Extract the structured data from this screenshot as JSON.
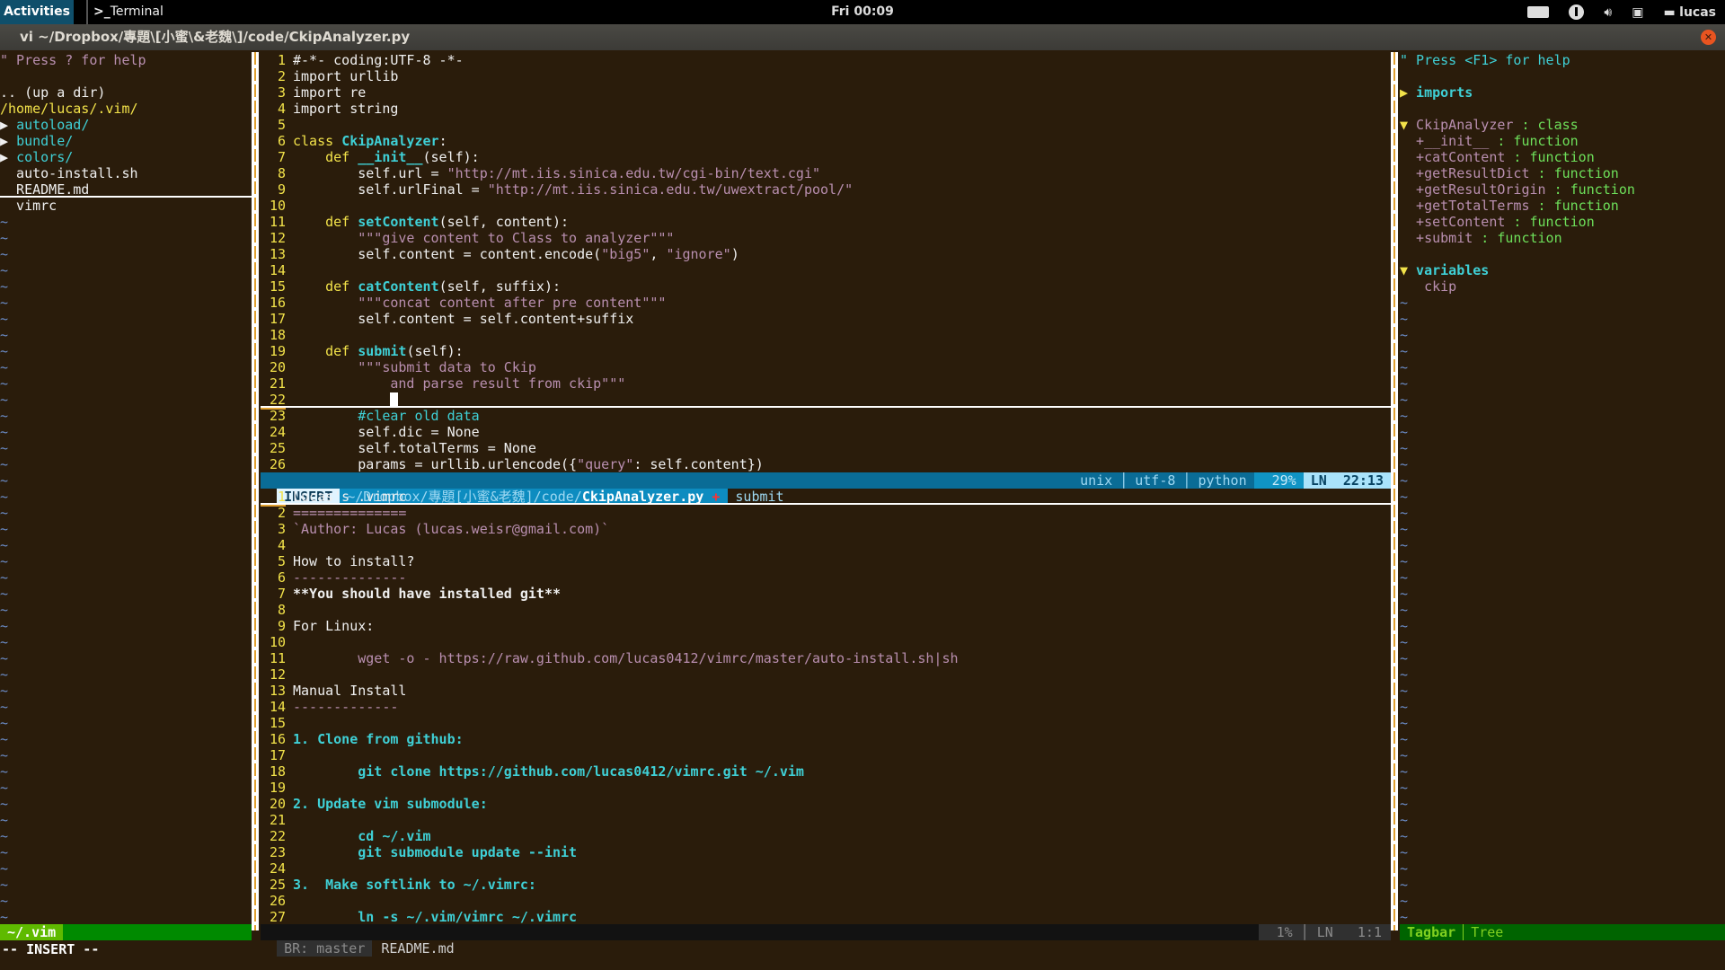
{
  "topbar": {
    "activities": "Activities",
    "app_name": "Terminal",
    "app_prompt": ">_",
    "clock": "Fri 00:09",
    "tray_icons": [
      "keyboard-icon",
      "accessibility-icon",
      "volume-icon",
      "network-icon",
      "chat-icon"
    ],
    "user": "lucas"
  },
  "window": {
    "title": "vi ~/Dropbox/專題\\[小蜜\\&老魏\\]/code/CkipAnalyzer.py",
    "close_icon": "close-icon"
  },
  "nerdtree": {
    "help": "\" Press ? for help",
    "up_dir": ".. (up a dir)",
    "root": "/home/lucas/.vim/",
    "entries": [
      {
        "type": "dir",
        "name": "autoload",
        "slash": "/"
      },
      {
        "type": "dir",
        "name": "bundle",
        "slash": "/"
      },
      {
        "type": "dir",
        "name": "colors",
        "slash": "/"
      },
      {
        "type": "file",
        "name": "auto-install.sh"
      },
      {
        "type": "file",
        "name": "README.md"
      },
      {
        "type": "file",
        "name": "vimrc"
      }
    ],
    "status": "~/.vim"
  },
  "editor_top": {
    "lines": [
      {
        "n": "1",
        "text": "#-*- coding:UTF-8 -*-"
      },
      {
        "n": "2",
        "text": "import urllib"
      },
      {
        "n": "3",
        "text": "import re"
      },
      {
        "n": "4",
        "text": "import string"
      },
      {
        "n": "5",
        "text": ""
      },
      {
        "n": "6",
        "kw": "class ",
        "name": "CkipAnalyzer",
        "rest": ":"
      },
      {
        "n": "7",
        "indent": "    ",
        "kw": "def ",
        "name": "__init__",
        "rest": "(self):"
      },
      {
        "n": "8",
        "indent": "        ",
        "pre": "self.url = ",
        "str": "\"http://mt.iis.sinica.edu.tw/cgi-bin/text.cgi\""
      },
      {
        "n": "9",
        "indent": "        ",
        "pre": "self.urlFinal = ",
        "str": "\"http://mt.iis.sinica.edu.tw/uwextract/pool/\""
      },
      {
        "n": "10",
        "text": ""
      },
      {
        "n": "11",
        "indent": "    ",
        "kw": "def ",
        "name": "setContent",
        "rest": "(self, content):"
      },
      {
        "n": "12",
        "indent": "        ",
        "str": "\"\"\"give content to Class to analyzer\"\"\""
      },
      {
        "n": "13",
        "indent": "        ",
        "pre": "self.content = content.encode(",
        "str": "\"big5\"",
        "mid": ", ",
        "str2": "\"ignore\"",
        "post": ")"
      },
      {
        "n": "14",
        "text": ""
      },
      {
        "n": "15",
        "indent": "    ",
        "kw": "def ",
        "name": "catContent",
        "rest": "(self, suffix):"
      },
      {
        "n": "16",
        "indent": "        ",
        "str": "\"\"\"concat content after pre content\"\"\""
      },
      {
        "n": "17",
        "indent": "        ",
        "pre": "self.content = self.content+suffix"
      },
      {
        "n": "18",
        "text": ""
      },
      {
        "n": "19",
        "indent": "    ",
        "kw": "def ",
        "name": "submit",
        "rest": "(self):"
      },
      {
        "n": "20",
        "indent": "        ",
        "str": "\"\"\"submit data to Ckip"
      },
      {
        "n": "21",
        "indent": "            ",
        "str": "and parse result from ckip\"\"\""
      },
      {
        "n": "22",
        "cursor": true
      },
      {
        "n": "23",
        "indent": "        ",
        "comment": "#clear old data"
      },
      {
        "n": "24",
        "indent": "        ",
        "pre": "self.dic = None"
      },
      {
        "n": "25",
        "indent": "        ",
        "pre": "self.totalTerms = None"
      },
      {
        "n": "26",
        "indent": "        ",
        "pre": "params = urllib.urlencode({",
        "str": "\"query\"",
        "post": ": self.content})"
      }
    ],
    "status": {
      "mode": "INSERT",
      "path_prefix": "~/Dropbox/專題[小蜜&老魏]/code/",
      "filename": "CkipAnalyzer.py",
      "modified": "+",
      "function": "submit",
      "fileformat": "unix",
      "encoding": "utf-8",
      "filetype": "python",
      "percent": "29%",
      "ln_label": "LN",
      "position": "22:13"
    }
  },
  "editor_bottom": {
    "lines": [
      {
        "n": "1",
        "text": "Lucas's .vimrc",
        "style": "white",
        "cursorline": true
      },
      {
        "n": "2",
        "text": "==============",
        "style": "pink"
      },
      {
        "n": "3",
        "text": "`Author: Lucas (lucas.weisr@gmail.com)`",
        "style": "pink"
      },
      {
        "n": "4",
        "text": ""
      },
      {
        "n": "5",
        "text": "How to install?",
        "style": "white"
      },
      {
        "n": "6",
        "text": "--------------",
        "style": "pink"
      },
      {
        "n": "7",
        "text": "**You should have installed git**",
        "style": "white-bold"
      },
      {
        "n": "8",
        "text": ""
      },
      {
        "n": "9",
        "text": "For Linux:",
        "style": "white"
      },
      {
        "n": "10",
        "text": ""
      },
      {
        "n": "11",
        "text": "        wget -o - https://raw.github.com/lucas0412/vimrc/master/auto-install.sh|sh",
        "style": "pink"
      },
      {
        "n": "12",
        "text": ""
      },
      {
        "n": "13",
        "text": "Manual Install",
        "style": "white"
      },
      {
        "n": "14",
        "text": "-------------",
        "style": "pink"
      },
      {
        "n": "15",
        "text": ""
      },
      {
        "n": "16",
        "text": "1. Clone from github:",
        "style": "cyan-bold"
      },
      {
        "n": "17",
        "text": ""
      },
      {
        "n": "18",
        "text": "        git clone https://github.com/lucas0412/vimrc.git ~/.vim",
        "style": "cyan-bold"
      },
      {
        "n": "19",
        "text": ""
      },
      {
        "n": "20",
        "text": "2. Update vim submodule:",
        "style": "cyan-bold"
      },
      {
        "n": "21",
        "text": ""
      },
      {
        "n": "22",
        "text": "        cd ~/.vim",
        "style": "cyan-bold"
      },
      {
        "n": "23",
        "text": "        git submodule update --init",
        "style": "cyan-bold"
      },
      {
        "n": "24",
        "text": ""
      },
      {
        "n": "25",
        "text": "3.  Make softlink to ~/.vimrc:",
        "style": "cyan-bold"
      },
      {
        "n": "26",
        "text": ""
      },
      {
        "n": "27",
        "text": "        ln -s ~/.vim/vimrc ~/.vimrc",
        "style": "cyan-bold"
      }
    ],
    "status": {
      "branch": "BR: master",
      "filename": "README.md",
      "percent": "1%",
      "ln_label": "LN",
      "position": "1:1"
    }
  },
  "tagbar": {
    "help": "\" Press <F1> for help",
    "groups": [
      {
        "name": "imports",
        "collapsed": true,
        "items": []
      },
      {
        "name": "CkipAnalyzer",
        "kind": " : class",
        "collapsed": false,
        "items": [
          {
            "name": "+__init__",
            "kind": " : function"
          },
          {
            "name": "+catContent",
            "kind": " : function"
          },
          {
            "name": "+getResultDict",
            "kind": " : function"
          },
          {
            "name": "+getResultOrigin",
            "kind": " : function"
          },
          {
            "name": "+getTotalTerms",
            "kind": " : function"
          },
          {
            "name": "+setContent",
            "kind": " : function"
          },
          {
            "name": "+submit",
            "kind": " : function"
          }
        ]
      },
      {
        "name": "variables",
        "collapsed": false,
        "items": [
          {
            "name": "ckip",
            "kind": ""
          }
        ]
      }
    ],
    "status_a": "Tagbar",
    "status_b": "Tree"
  },
  "cmdline": "-- INSERT --",
  "colors": {
    "background": "#2a1c0b",
    "statusline_blue": "#0a6c96",
    "statusline_green": "#008a00",
    "linenr": "#f2e24a",
    "function": "#3fd0d6",
    "string": "#b98fb0"
  }
}
